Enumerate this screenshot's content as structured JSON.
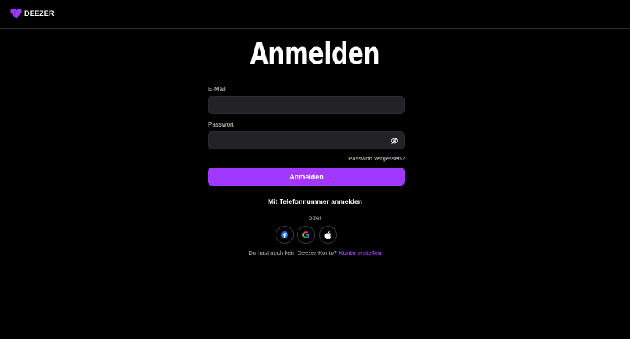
{
  "brand": {
    "name": "DEEZER",
    "accent_color": "#a238ff"
  },
  "page": {
    "title": "Anmelden"
  },
  "form": {
    "email_label": "E-Mail",
    "email_value": "",
    "password_label": "Passwort",
    "password_value": "",
    "password_toggle_icon": "eye-off-icon",
    "forgot_password": "Passwort vergessen?",
    "submit_label": "Anmelden"
  },
  "alt_login": {
    "phone_link": "Mit Telefonnummer anmelden",
    "separator": "oder",
    "providers": [
      {
        "name": "Facebook",
        "icon": "facebook-icon",
        "color": "#1877f2"
      },
      {
        "name": "Google",
        "icon": "google-icon"
      },
      {
        "name": "Apple",
        "icon": "apple-icon",
        "color": "#ffffff"
      }
    ]
  },
  "signup": {
    "prompt": "Du hast noch kein Deezer-Konto?",
    "link": "Konto erstellen"
  }
}
